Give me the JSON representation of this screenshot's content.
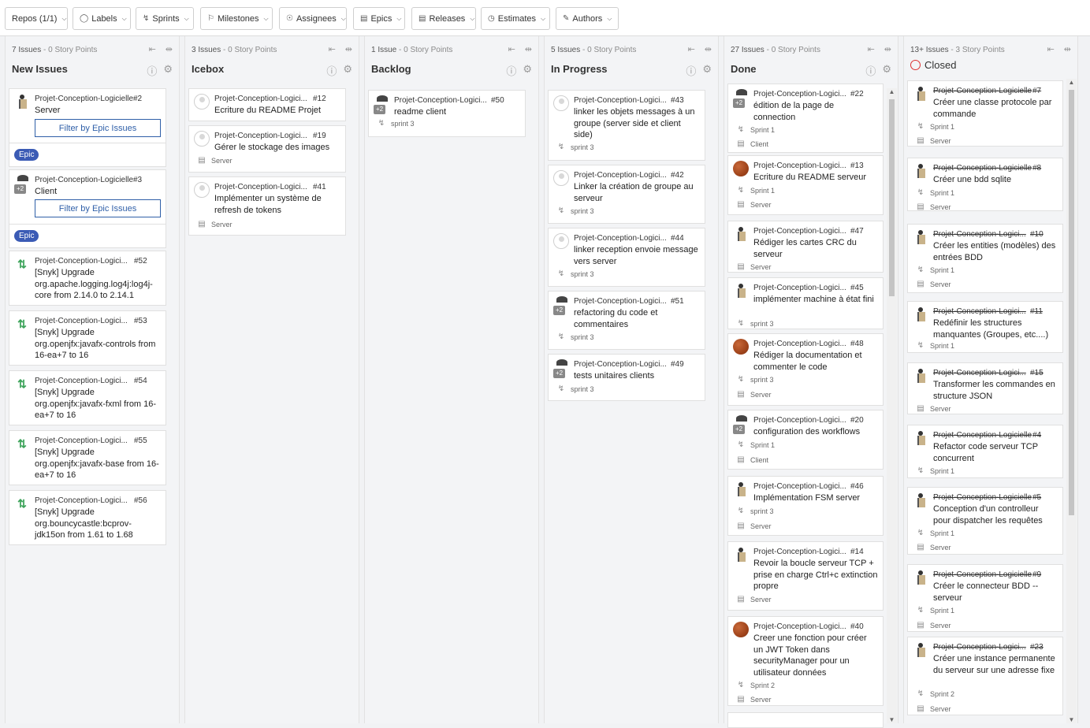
{
  "toolbar": {
    "filters": [
      {
        "label": "Repos (1/1)",
        "icon": ""
      },
      {
        "label": "Labels",
        "icon": "tag-icon"
      },
      {
        "label": "Sprints",
        "icon": "sprint-icon"
      },
      {
        "label": "Milestones",
        "icon": "milestone-icon"
      },
      {
        "label": "Assignees",
        "icon": "assignee-icon"
      },
      {
        "label": "Epics",
        "icon": "epic-icon"
      },
      {
        "label": "Releases",
        "icon": "release-icon"
      },
      {
        "label": "Estimates",
        "icon": "estimate-icon"
      },
      {
        "label": "Authors",
        "icon": "author-icon"
      }
    ]
  },
  "columns": [
    {
      "issues": "7 Issues",
      "points": " - 0 Story Points",
      "title": "New Issues",
      "cards": [
        {
          "repo": "Projet-Conception-Logicielle",
          "num": "#2",
          "title": "Server",
          "epic_button": "Filter by Epic Issues",
          "badge": "Epic"
        },
        {
          "repo": "Projet-Conception-Logicielle",
          "num": "#3",
          "title": "Client",
          "epic_button": "Filter by Epic Issues",
          "badge": "Epic"
        },
        {
          "repo": "Projet-Conception-Logici...",
          "num": "#52",
          "title": "[Snyk] Upgrade org.apache.logging.log4j:log4j-core from 2.14.0 to 2.14.1"
        },
        {
          "repo": "Projet-Conception-Logici...",
          "num": "#53",
          "title": "[Snyk] Upgrade org.openjfx:javafx-controls from 16-ea+7 to 16"
        },
        {
          "repo": "Projet-Conception-Logici...",
          "num": "#54",
          "title": "[Snyk] Upgrade org.openjfx:javafx-fxml from 16-ea+7 to 16"
        },
        {
          "repo": "Projet-Conception-Logici...",
          "num": "#55",
          "title": "[Snyk] Upgrade org.openjfx:javafx-base from 16-ea+7 to 16"
        },
        {
          "repo": "Projet-Conception-Logici...",
          "num": "#56",
          "title": "[Snyk] Upgrade org.bouncycastle:bcprov-jdk15on from 1.61 to 1.68"
        }
      ]
    },
    {
      "issues": "3 Issues",
      "points": " - 0 Story Points",
      "title": "Icebox",
      "cards": [
        {
          "repo": "Projet-Conception-Logici...",
          "num": "#12",
          "title": "Ecriture du README Projet"
        },
        {
          "repo": "Projet-Conception-Logici...",
          "num": "#19",
          "title": "Gérer le stockage des images",
          "epic": "Server"
        },
        {
          "repo": "Projet-Conception-Logici...",
          "num": "#41",
          "title": "Implémenter un système de refresh de tokens",
          "epic": "Server"
        }
      ]
    },
    {
      "issues": "1 Issue",
      "points": " - 0 Story Points",
      "title": "Backlog",
      "cards": [
        {
          "repo": "Projet-Conception-Logici...",
          "num": "#50",
          "title": "readme client",
          "sprint": "sprint 3"
        }
      ]
    },
    {
      "issues": "5 Issues",
      "points": " - 0 Story Points",
      "title": "In Progress",
      "cards": [
        {
          "repo": "Projet-Conception-Logici...",
          "num": "#43",
          "title": "linker les objets messages à un groupe (server side et client side)",
          "sprint": "sprint 3"
        },
        {
          "repo": "Projet-Conception-Logici...",
          "num": "#42",
          "title": "Linker la création de groupe au serveur",
          "sprint": "sprint 3"
        },
        {
          "repo": "Projet-Conception-Logici...",
          "num": "#44",
          "title": "linker reception envoie message vers server",
          "sprint": "sprint 3"
        },
        {
          "repo": "Projet-Conception-Logici...",
          "num": "#51",
          "title": "refactoring du code et commentaires",
          "sprint": "sprint 3"
        },
        {
          "repo": "Projet-Conception-Logici...",
          "num": "#49",
          "title": "tests unitaires clients",
          "sprint": "sprint 3"
        }
      ]
    },
    {
      "issues": "27 Issues",
      "points": " - 0 Story Points",
      "title": "Done",
      "cards": [
        {
          "repo": "Projet-Conception-Logici...",
          "num": "#22",
          "title": "édition de la page de connection",
          "sprint": "Sprint 1",
          "epic": "Client"
        },
        {
          "repo": "Projet-Conception-Logici...",
          "num": "#13",
          "title": "Ecriture du README serveur",
          "sprint": "Sprint 1",
          "epic": "Server"
        },
        {
          "repo": "Projet-Conception-Logici...",
          "num": "#47",
          "title": "Rédiger les cartes CRC du serveur",
          "epic": "Server"
        },
        {
          "repo": "Projet-Conception-Logici...",
          "num": "#45",
          "title": "implémenter machine à état fini",
          "sprint": "sprint 3"
        },
        {
          "repo": "Projet-Conception-Logici...",
          "num": "#48",
          "title": "Rédiger la documentation et commenter le code",
          "sprint": "sprint 3",
          "epic": "Server"
        },
        {
          "repo": "Projet-Conception-Logici...",
          "num": "#20",
          "title": "configuration des workflows",
          "sprint": "Sprint 1",
          "epic": "Client"
        },
        {
          "repo": "Projet-Conception-Logici...",
          "num": "#46",
          "title": "Implémentation FSM server",
          "sprint": "sprint 3",
          "epic": "Server"
        },
        {
          "repo": "Projet-Conception-Logici...",
          "num": "#14",
          "title": "Revoir la boucle serveur TCP + prise en charge Ctrl+c extinction propre",
          "epic": "Server"
        },
        {
          "repo": "Projet-Conception-Logici...",
          "num": "#40",
          "title": "Creer une fonction pour créer un JWT Token dans securityManager pour un utilisateur données",
          "sprint": "Sprint 2",
          "epic": "Server"
        }
      ]
    },
    {
      "issues": "13+ Issues",
      "points": " - 3 Story Points",
      "title": "Closed",
      "cards": [
        {
          "repo": "Projet-Conception-Logicielle",
          "num": "#7",
          "title": "Créer une classe protocole par commande",
          "sprint": "Sprint 1",
          "epic": "Server"
        },
        {
          "repo": "Projet-Conception-Logicielle",
          "num": "#8",
          "title": "Créer une bdd sqlite",
          "sprint": "Sprint 1",
          "epic": "Server"
        },
        {
          "repo": "Projet-Conception-Logici...",
          "num": "#10",
          "title": "Créer les entities (modèles) des entrées BDD",
          "sprint": "Sprint 1",
          "epic": "Server"
        },
        {
          "repo": "Projet-Conception-Logici...",
          "num": "#11",
          "title": "Redéfinir les structures manquantes (Groupes, etc....)",
          "sprint": "Sprint 1"
        },
        {
          "repo": "Projet-Conception-Logici...",
          "num": "#15",
          "title": "Transformer les commandes en structure JSON",
          "epic": "Server"
        },
        {
          "repo": "Projet-Conception-Logicielle",
          "num": "#4",
          "title": "Refactor code serveur TCP concurrent",
          "sprint": "Sprint 1"
        },
        {
          "repo": "Projet-Conception-Logicielle",
          "num": "#5",
          "title": "Conception d'un controlleur pour dispatcher les requêtes",
          "sprint": "Sprint 1",
          "epic": "Server"
        },
        {
          "repo": "Projet-Conception-Logicielle",
          "num": "#9",
          "title": "Créer le connecteur BDD -- serveur",
          "sprint": "Sprint 1",
          "epic": "Server"
        },
        {
          "repo": "Projet-Conception-Logici...",
          "num": "#23",
          "title": "Créer une instance permanente du serveur sur une adresse fixe",
          "sprint": "Sprint 2",
          "epic": "Server"
        }
      ]
    }
  ]
}
